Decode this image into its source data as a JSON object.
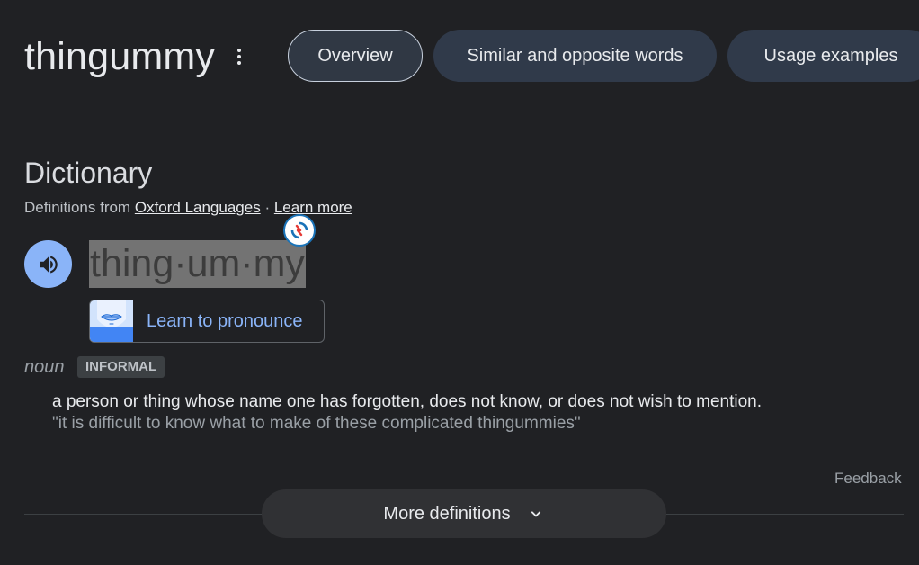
{
  "header": {
    "word": "thingummy",
    "tabs": [
      {
        "label": "Overview",
        "selected": true
      },
      {
        "label": "Similar and opposite words",
        "selected": false
      },
      {
        "label": "Usage examples",
        "selected": false
      }
    ]
  },
  "dictionary": {
    "heading": "Dictionary",
    "source_prefix": "Definitions from ",
    "source_link": "Oxford Languages",
    "separator": " · ",
    "learn_more": "Learn more",
    "phonetic": "thing·um·my",
    "pronounce_label": "Learn to pronounce",
    "part_of_speech": "noun",
    "register": "INFORMAL",
    "definition": "a person or thing whose name one has forgotten, does not know, or does not wish to mention.",
    "example": "\"it is difficult to know what to make of these complicated thingummies\""
  },
  "footer": {
    "feedback": "Feedback",
    "more_definitions": "More definitions"
  },
  "colors": {
    "background": "#202124",
    "accent_blue": "#8ab4f8",
    "tab_bg": "#303a4a",
    "highlight": "#737373"
  },
  "icons": {
    "menu": "kebab-menu-icon",
    "speaker": "speaker-icon",
    "translate": "translate-refresh-icon",
    "pronounce": "lips-icon",
    "expand": "chevron-down-icon"
  }
}
